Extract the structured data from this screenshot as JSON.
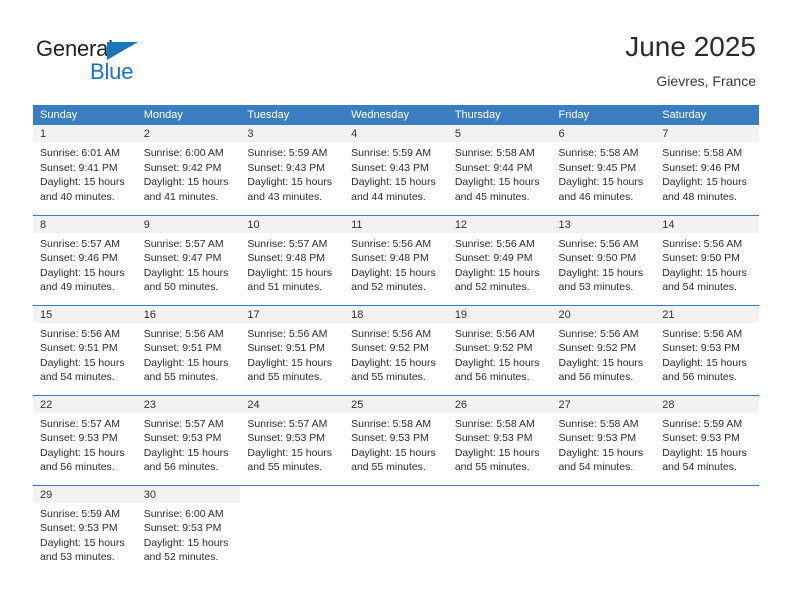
{
  "brand": {
    "name_top": "General",
    "name_bottom": "Blue",
    "triangle_color": "#1b75bb",
    "text_color": "#231f20"
  },
  "header": {
    "title": "June 2025",
    "subtitle": "Gievres, France"
  },
  "theme": {
    "header_blue": "#3a7dc0",
    "daynum_band": "#f2f2f2",
    "text": "#2d2d2d"
  },
  "weekday_headers": [
    "Sunday",
    "Monday",
    "Tuesday",
    "Wednesday",
    "Thursday",
    "Friday",
    "Saturday"
  ],
  "weeks": [
    [
      {
        "day": "1",
        "sunrise": "Sunrise: 6:01 AM",
        "sunset": "Sunset: 9:41 PM",
        "daylight1": "Daylight: 15 hours",
        "daylight2": "and 40 minutes."
      },
      {
        "day": "2",
        "sunrise": "Sunrise: 6:00 AM",
        "sunset": "Sunset: 9:42 PM",
        "daylight1": "Daylight: 15 hours",
        "daylight2": "and 41 minutes."
      },
      {
        "day": "3",
        "sunrise": "Sunrise: 5:59 AM",
        "sunset": "Sunset: 9:43 PM",
        "daylight1": "Daylight: 15 hours",
        "daylight2": "and 43 minutes."
      },
      {
        "day": "4",
        "sunrise": "Sunrise: 5:59 AM",
        "sunset": "Sunset: 9:43 PM",
        "daylight1": "Daylight: 15 hours",
        "daylight2": "and 44 minutes."
      },
      {
        "day": "5",
        "sunrise": "Sunrise: 5:58 AM",
        "sunset": "Sunset: 9:44 PM",
        "daylight1": "Daylight: 15 hours",
        "daylight2": "and 45 minutes."
      },
      {
        "day": "6",
        "sunrise": "Sunrise: 5:58 AM",
        "sunset": "Sunset: 9:45 PM",
        "daylight1": "Daylight: 15 hours",
        "daylight2": "and 46 minutes."
      },
      {
        "day": "7",
        "sunrise": "Sunrise: 5:58 AM",
        "sunset": "Sunset: 9:46 PM",
        "daylight1": "Daylight: 15 hours",
        "daylight2": "and 48 minutes."
      }
    ],
    [
      {
        "day": "8",
        "sunrise": "Sunrise: 5:57 AM",
        "sunset": "Sunset: 9:46 PM",
        "daylight1": "Daylight: 15 hours",
        "daylight2": "and 49 minutes."
      },
      {
        "day": "9",
        "sunrise": "Sunrise: 5:57 AM",
        "sunset": "Sunset: 9:47 PM",
        "daylight1": "Daylight: 15 hours",
        "daylight2": "and 50 minutes."
      },
      {
        "day": "10",
        "sunrise": "Sunrise: 5:57 AM",
        "sunset": "Sunset: 9:48 PM",
        "daylight1": "Daylight: 15 hours",
        "daylight2": "and 51 minutes."
      },
      {
        "day": "11",
        "sunrise": "Sunrise: 5:56 AM",
        "sunset": "Sunset: 9:48 PM",
        "daylight1": "Daylight: 15 hours",
        "daylight2": "and 52 minutes."
      },
      {
        "day": "12",
        "sunrise": "Sunrise: 5:56 AM",
        "sunset": "Sunset: 9:49 PM",
        "daylight1": "Daylight: 15 hours",
        "daylight2": "and 52 minutes."
      },
      {
        "day": "13",
        "sunrise": "Sunrise: 5:56 AM",
        "sunset": "Sunset: 9:50 PM",
        "daylight1": "Daylight: 15 hours",
        "daylight2": "and 53 minutes."
      },
      {
        "day": "14",
        "sunrise": "Sunrise: 5:56 AM",
        "sunset": "Sunset: 9:50 PM",
        "daylight1": "Daylight: 15 hours",
        "daylight2": "and 54 minutes."
      }
    ],
    [
      {
        "day": "15",
        "sunrise": "Sunrise: 5:56 AM",
        "sunset": "Sunset: 9:51 PM",
        "daylight1": "Daylight: 15 hours",
        "daylight2": "and 54 minutes."
      },
      {
        "day": "16",
        "sunrise": "Sunrise: 5:56 AM",
        "sunset": "Sunset: 9:51 PM",
        "daylight1": "Daylight: 15 hours",
        "daylight2": "and 55 minutes."
      },
      {
        "day": "17",
        "sunrise": "Sunrise: 5:56 AM",
        "sunset": "Sunset: 9:51 PM",
        "daylight1": "Daylight: 15 hours",
        "daylight2": "and 55 minutes."
      },
      {
        "day": "18",
        "sunrise": "Sunrise: 5:56 AM",
        "sunset": "Sunset: 9:52 PM",
        "daylight1": "Daylight: 15 hours",
        "daylight2": "and 55 minutes."
      },
      {
        "day": "19",
        "sunrise": "Sunrise: 5:56 AM",
        "sunset": "Sunset: 9:52 PM",
        "daylight1": "Daylight: 15 hours",
        "daylight2": "and 56 minutes."
      },
      {
        "day": "20",
        "sunrise": "Sunrise: 5:56 AM",
        "sunset": "Sunset: 9:52 PM",
        "daylight1": "Daylight: 15 hours",
        "daylight2": "and 56 minutes."
      },
      {
        "day": "21",
        "sunrise": "Sunrise: 5:56 AM",
        "sunset": "Sunset: 9:53 PM",
        "daylight1": "Daylight: 15 hours",
        "daylight2": "and 56 minutes."
      }
    ],
    [
      {
        "day": "22",
        "sunrise": "Sunrise: 5:57 AM",
        "sunset": "Sunset: 9:53 PM",
        "daylight1": "Daylight: 15 hours",
        "daylight2": "and 56 minutes."
      },
      {
        "day": "23",
        "sunrise": "Sunrise: 5:57 AM",
        "sunset": "Sunset: 9:53 PM",
        "daylight1": "Daylight: 15 hours",
        "daylight2": "and 56 minutes."
      },
      {
        "day": "24",
        "sunrise": "Sunrise: 5:57 AM",
        "sunset": "Sunset: 9:53 PM",
        "daylight1": "Daylight: 15 hours",
        "daylight2": "and 55 minutes."
      },
      {
        "day": "25",
        "sunrise": "Sunrise: 5:58 AM",
        "sunset": "Sunset: 9:53 PM",
        "daylight1": "Daylight: 15 hours",
        "daylight2": "and 55 minutes."
      },
      {
        "day": "26",
        "sunrise": "Sunrise: 5:58 AM",
        "sunset": "Sunset: 9:53 PM",
        "daylight1": "Daylight: 15 hours",
        "daylight2": "and 55 minutes."
      },
      {
        "day": "27",
        "sunrise": "Sunrise: 5:58 AM",
        "sunset": "Sunset: 9:53 PM",
        "daylight1": "Daylight: 15 hours",
        "daylight2": "and 54 minutes."
      },
      {
        "day": "28",
        "sunrise": "Sunrise: 5:59 AM",
        "sunset": "Sunset: 9:53 PM",
        "daylight1": "Daylight: 15 hours",
        "daylight2": "and 54 minutes."
      }
    ],
    [
      {
        "day": "29",
        "sunrise": "Sunrise: 5:59 AM",
        "sunset": "Sunset: 9:53 PM",
        "daylight1": "Daylight: 15 hours",
        "daylight2": "and 53 minutes."
      },
      {
        "day": "30",
        "sunrise": "Sunrise: 6:00 AM",
        "sunset": "Sunset: 9:53 PM",
        "daylight1": "Daylight: 15 hours",
        "daylight2": "and 52 minutes."
      },
      {
        "day": "",
        "sunrise": "",
        "sunset": "",
        "daylight1": "",
        "daylight2": ""
      },
      {
        "day": "",
        "sunrise": "",
        "sunset": "",
        "daylight1": "",
        "daylight2": ""
      },
      {
        "day": "",
        "sunrise": "",
        "sunset": "",
        "daylight1": "",
        "daylight2": ""
      },
      {
        "day": "",
        "sunrise": "",
        "sunset": "",
        "daylight1": "",
        "daylight2": ""
      },
      {
        "day": "",
        "sunrise": "",
        "sunset": "",
        "daylight1": "",
        "daylight2": ""
      }
    ]
  ]
}
